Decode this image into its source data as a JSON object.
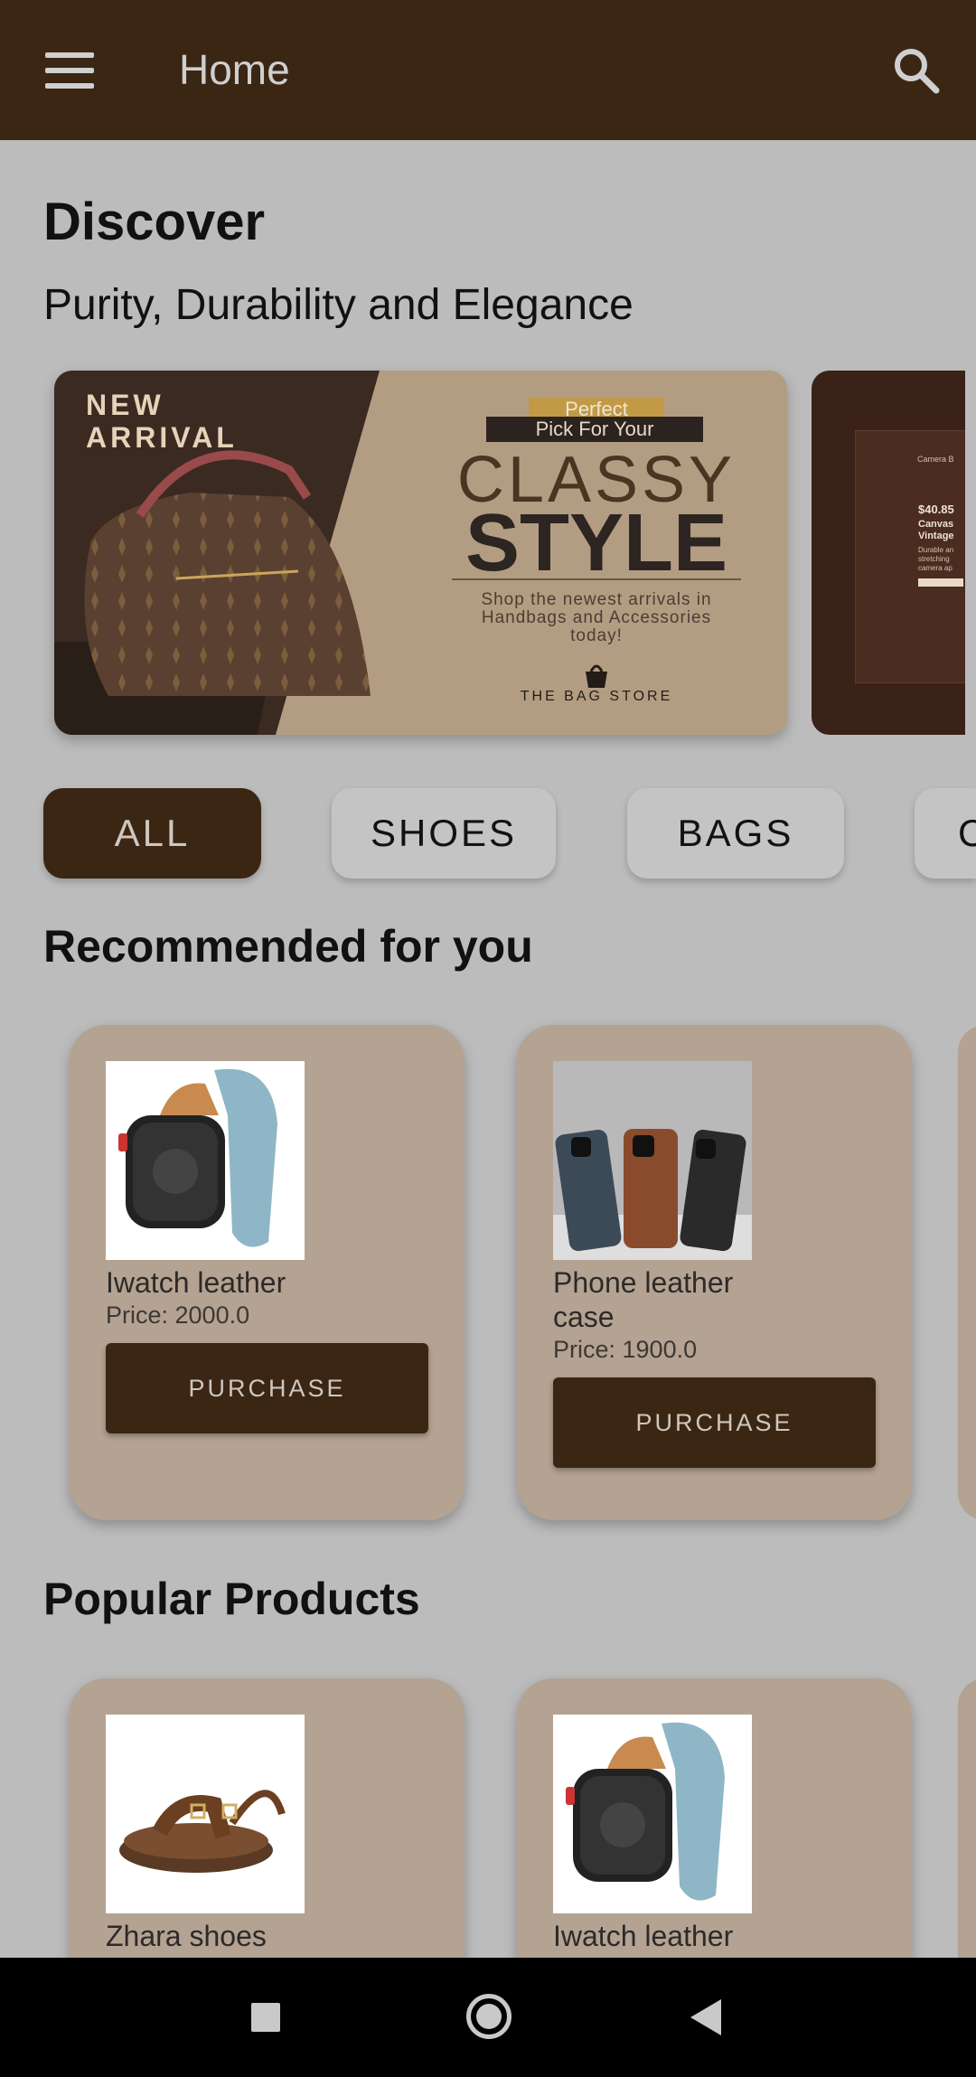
{
  "appbar": {
    "title": "Home"
  },
  "discover": {
    "title": "Discover",
    "tagline": "Purity, Durability and Elegance"
  },
  "banner": {
    "new_arrival": "NEW ARRIVAL",
    "perfect": "Perfect",
    "pick_for_your": "Pick For Your",
    "classy": "CLASSY",
    "style": "STYLE",
    "shop_text": "Shop the newest arrivals in Handbags and Accessories today!",
    "store": "THE BAG STORE",
    "next_title": "Camera B",
    "next_price": "$40.85",
    "next_name": "Canvas Vintage",
    "next_desc": "Durable an stretching camera ap"
  },
  "chips": [
    {
      "label": "ALL",
      "active": true
    },
    {
      "label": "SHOES",
      "active": false
    },
    {
      "label": "BAGS",
      "active": false
    },
    {
      "label": "C",
      "active": false
    }
  ],
  "recommended": {
    "title": "Recommended for you",
    "items": [
      {
        "name": "Iwatch leather",
        "price": "Price: 2000.0",
        "button": "PURCHASE"
      },
      {
        "name": "Phone leather case",
        "price": "Price: 1900.0",
        "button": "PURCHASE"
      }
    ]
  },
  "popular": {
    "title": "Popular Products",
    "items": [
      {
        "name": "Zhara shoes"
      },
      {
        "name": "Iwatch leather"
      }
    ]
  },
  "colors": {
    "primary": "#3b2614",
    "card": "#b4a292",
    "background": "#bcbcbc"
  }
}
